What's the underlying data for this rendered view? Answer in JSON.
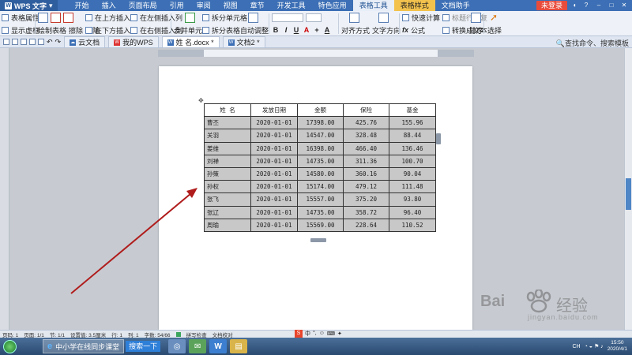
{
  "app": {
    "name": "WPS 文字"
  },
  "menu": {
    "tabs": [
      "开始",
      "插入",
      "页面布局",
      "引用",
      "审阅",
      "视图",
      "章节",
      "开发工具",
      "特色应用",
      "表格工具",
      "表格样式",
      "文档助手"
    ],
    "login": "未登录"
  },
  "ribbon": {
    "table_props": "表格属性",
    "show_gridlines": "显示虚框",
    "draw_table": "绘制表格",
    "erase": "擦除",
    "delete": "删除",
    "insert_above": "在上方插入行",
    "insert_below": "在下方插入行",
    "insert_left": "在左侧插入列",
    "insert_right": "在右侧插入列",
    "merge": "合并单元格",
    "split_cell": "拆分单元格",
    "split_table": "拆分表格",
    "autofit": "自动调整",
    "align": "对齐方式",
    "text_dir": "文字方向",
    "quick_calc": "快速计算",
    "formula": "公式",
    "title_repeat": "标题行重复",
    "convert_text": "转换成文本",
    "sort": "排序",
    "select": "选择"
  },
  "tabbar": {
    "cloud": "云文档",
    "mywps": "我的WPS",
    "doc1": "姓 名.docx *",
    "doc2": "文档2 *",
    "search": "查找命令、搜索模板"
  },
  "table": {
    "headers": [
      "姓  名",
      "发放日期",
      "金额",
      "保险",
      "基金"
    ],
    "rows": [
      [
        "曹丕",
        "2020-01-01",
        "17398.00",
        "425.76",
        "155.96"
      ],
      [
        "关羽",
        "2020-01-01",
        "14547.00",
        "328.48",
        "88.44"
      ],
      [
        "姜维",
        "2020-01-01",
        "16398.00",
        "466.40",
        "136.46"
      ],
      [
        "刘禅",
        "2020-01-01",
        "14735.00",
        "311.36",
        "100.70"
      ],
      [
        "孙策",
        "2020-01-01",
        "14580.00",
        "360.16",
        "90.04"
      ],
      [
        "孙权",
        "2020-01-01",
        "15174.00",
        "479.12",
        "111.48"
      ],
      [
        "张飞",
        "2020-01-01",
        "15557.00",
        "375.20",
        "93.80"
      ],
      [
        "张辽",
        "2020-01-01",
        "14735.00",
        "358.72",
        "96.40"
      ],
      [
        "周瑜",
        "2020-01-01",
        "15569.00",
        "228.64",
        "110.52"
      ]
    ]
  },
  "status": {
    "items": [
      "页码: 1",
      "页面: 1/1",
      "节: 1/1",
      "设置值: 3.5厘米",
      "行: 1",
      "列: 1",
      "字数: 54/66",
      "拼写检查",
      "文档校对"
    ],
    "ime": [
      "中",
      "°,",
      "☺",
      "⌨",
      "✦"
    ]
  },
  "taskbar": {
    "ie_label": "中小学在线同步课堂",
    "search": "搜索一下",
    "time": "15:50",
    "date": "2020/4/1",
    "lang": "CH"
  },
  "watermark": {
    "brand": "Bai",
    "cn": "经验",
    "url": "jingyan.baidu.com"
  },
  "colors": {
    "menubar": "#3c6fb5",
    "context_tab": "#f3c24d",
    "arrow": "#b01c1c",
    "table_fill": "#c8c8c8"
  }
}
